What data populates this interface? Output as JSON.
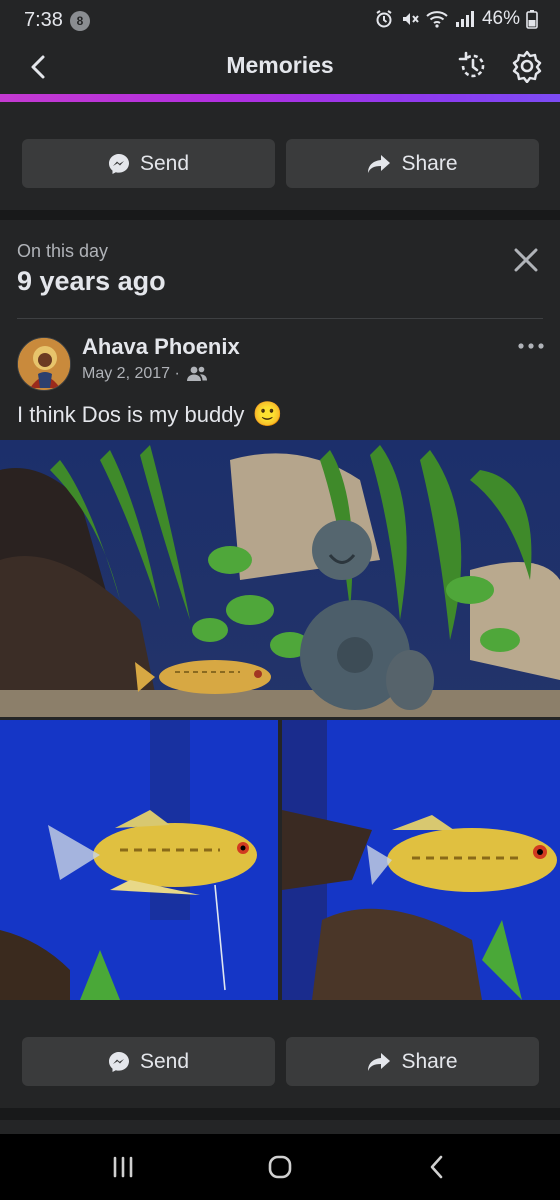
{
  "status_bar": {
    "time": "7:38",
    "notification_count": "8",
    "battery": "46%"
  },
  "header": {
    "title": "Memories",
    "back_icon": "chevron-left-icon",
    "history_icon": "history-icon",
    "settings_icon": "gear-icon"
  },
  "top_actions": {
    "send_label": "Send",
    "share_label": "Share"
  },
  "memory": {
    "eyebrow": "On this day",
    "years_ago": "9 years ago",
    "post": {
      "author": "Ahava Phoenix",
      "date": "May 2, 2017 ·",
      "audience_icon": "friends-icon",
      "text": "I think Dos is my buddy",
      "emoji": "🙂",
      "photos": [
        "aquarium-buddha-photo",
        "gourami-left-photo",
        "gourami-right-photo"
      ]
    }
  },
  "bottom_actions": {
    "send_label": "Send",
    "share_label": "Share"
  },
  "colors": {
    "background": "#242526",
    "button": "#3a3b3c",
    "accent_gradient_start": "#c43ad1",
    "accent_gradient_end": "#7c4cf4",
    "text_primary": "#e4e6eb",
    "text_secondary": "#b0b3b8"
  }
}
